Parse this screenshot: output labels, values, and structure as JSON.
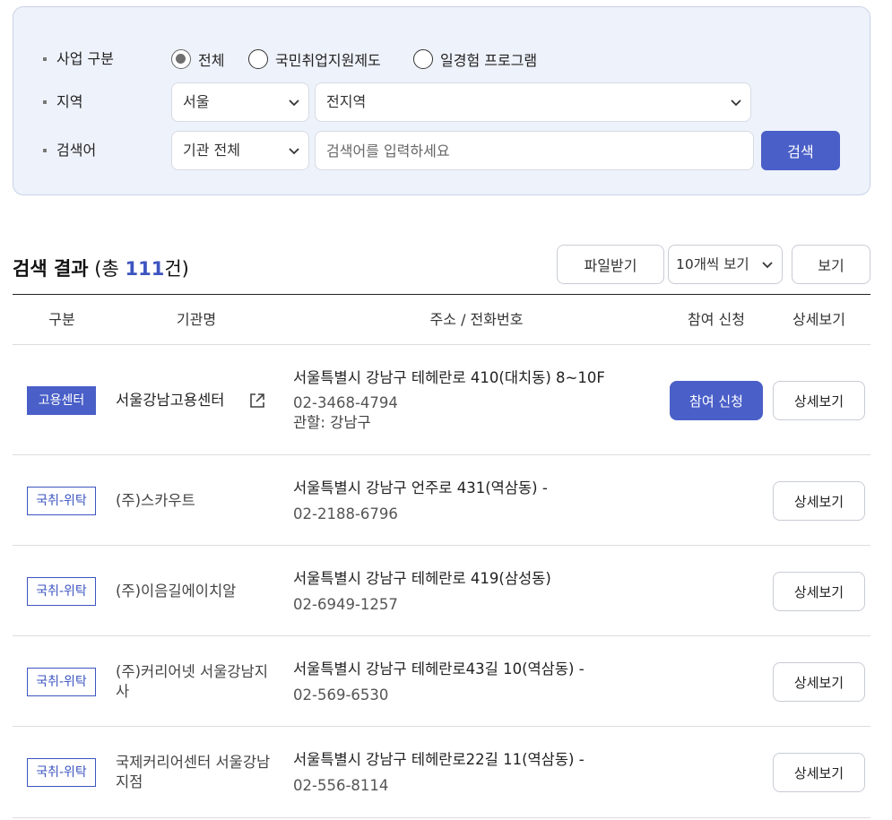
{
  "filters": {
    "business_type": {
      "label": "사업 구분",
      "options": [
        "전체",
        "국민취업지원제도",
        "일경험 프로그램"
      ],
      "selected": "전체"
    },
    "region": {
      "label": "지역",
      "city": "서울",
      "district": "전지역"
    },
    "keyword": {
      "label": "검색어",
      "scope": "기관 전체",
      "placeholder": "검색어를 입력하세요",
      "value": "",
      "search_label": "검색"
    }
  },
  "results": {
    "title": "검색 결과",
    "count_prefix": "(총 ",
    "count": "111",
    "count_suffix": "건)",
    "download_label": "파일받기",
    "page_size": "10개씩 보기",
    "view_label": "보기"
  },
  "table": {
    "headers": [
      "구분",
      "기관명",
      "주소 / 전화번호",
      "참여 신청",
      "상세보기"
    ],
    "rows": [
      {
        "category": "고용센터",
        "org": "서울강남고용센터",
        "address": "서울특별시 강남구 테헤란로 410(대치동) 8~10F",
        "phone": "02-3468-4794",
        "jurisdiction": "관할: 강남구",
        "apply_label": "참여 신청",
        "detail_label": "상세보기"
      },
      {
        "category": "국취-위탁",
        "org": "(주)스카우트",
        "address": "서울특별시 강남구 언주로 431(역삼동) -",
        "phone": "02-2188-6796",
        "detail_label": "상세보기"
      },
      {
        "category": "국취-위탁",
        "org": "(주)이음길에이치알",
        "address": "서울특별시 강남구 테헤란로 419(삼성동)",
        "phone": "02-6949-1257",
        "detail_label": "상세보기"
      },
      {
        "category": "국취-위탁",
        "org": "(주)커리어넷 서울강남지사",
        "address": "서울특별시 강남구 테헤란로43길 10(역삼동) -",
        "phone": "02-569-6530",
        "detail_label": "상세보기"
      },
      {
        "category": "국취-위탁",
        "org": "국제커리어센터 서울강남지점",
        "address": "서울특별시 강남구 테헤란로22길 11(역삼동) -",
        "phone": "02-556-8114",
        "detail_label": "상세보기"
      }
    ]
  },
  "colors": {
    "accent": "#4a5fc8",
    "panel_bg": "#eef2fb",
    "count_color": "#3d55c0"
  },
  "icons": [
    "chevron-down-icon",
    "external-link-icon"
  ]
}
